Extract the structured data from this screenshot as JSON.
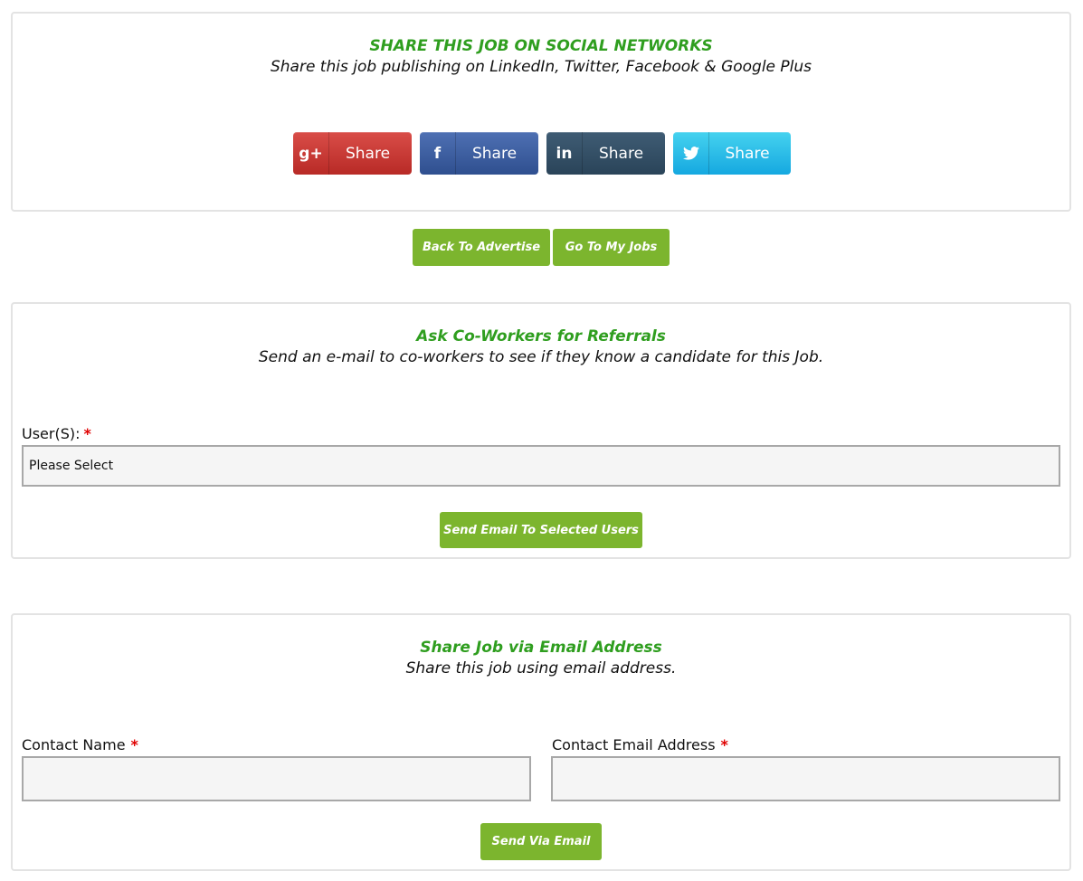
{
  "social": {
    "title": "SHARE THIS JOB ON SOCIAL NETWORKS",
    "subtitle": "Share this job publishing on LinkedIn, Twitter, Facebook & Google Plus",
    "buttons": [
      {
        "network": "google-plus",
        "icon": "g+",
        "label": "Share",
        "color": "#c9302c"
      },
      {
        "network": "facebook",
        "icon": "f",
        "label": "Share",
        "color": "#3b5998"
      },
      {
        "network": "linkedin",
        "icon": "in",
        "label": "Share",
        "color": "#34495e"
      },
      {
        "network": "twitter",
        "icon": "🐦",
        "label": "Share",
        "color": "#1fb6e8"
      }
    ]
  },
  "nav": {
    "back_label": "Back To Advertise",
    "jobs_label": "Go To My Jobs"
  },
  "referrals": {
    "title": "Ask Co-Workers for Referrals",
    "subtitle": "Send an e-mail to co-workers to see if they know a candidate for this Job.",
    "users_label": "User(S):",
    "required_mark": "*",
    "select_value": "Please Select",
    "send_label": "Send Email To Selected Users"
  },
  "email_share": {
    "title": "Share Job via Email Address",
    "subtitle": "Share this job using email address.",
    "name_label": "Contact Name",
    "email_label": "Contact Email Address",
    "required_mark": "*",
    "name_value": "",
    "email_value": "",
    "send_label": "Send Via Email"
  },
  "colors": {
    "accent_green": "#7cb52e",
    "title_green": "#2f9e1f",
    "required_red": "#e00000"
  }
}
